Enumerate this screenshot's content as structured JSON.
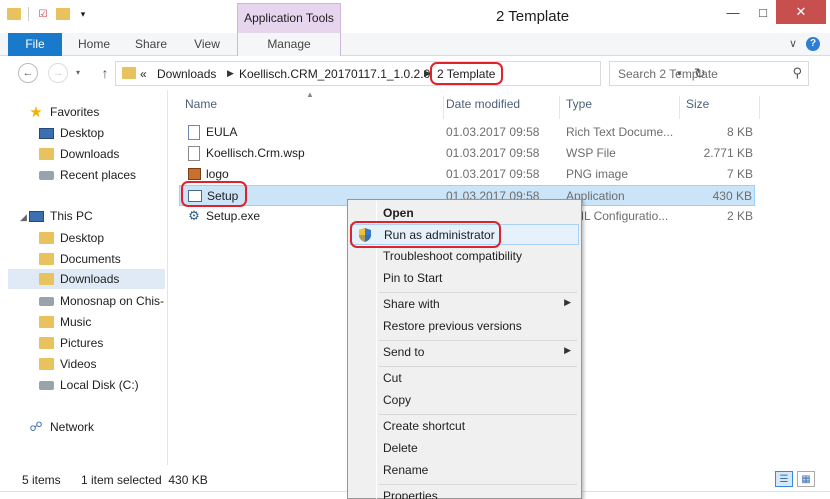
{
  "window": {
    "title": "2 Template",
    "contextual_tab_group": "Application Tools"
  },
  "ribbon": {
    "tabs": [
      "File",
      "Home",
      "Share",
      "View",
      "Manage"
    ]
  },
  "address": {
    "overflow": "«",
    "crumbs": [
      "Downloads",
      "Koellisch.CRM_20170117.1_1.0.2.0",
      "2 Template"
    ],
    "search_placeholder": "Search 2 Template"
  },
  "nav": {
    "favorites": {
      "label": "Favorites",
      "items": [
        "Desktop",
        "Downloads",
        "Recent places"
      ]
    },
    "this_pc": {
      "label": "This PC",
      "items": [
        "Desktop",
        "Documents",
        "Downloads",
        "Monosnap on Chis-",
        "Music",
        "Pictures",
        "Videos",
        "Local Disk (C:)"
      ]
    },
    "network": {
      "label": "Network"
    }
  },
  "columns": [
    "Name",
    "Date modified",
    "Type",
    "Size"
  ],
  "files": [
    {
      "name": "EULA",
      "date": "01.03.2017 09:58",
      "type": "Rich Text Docume...",
      "size": "8 KB",
      "icon": "rtf-icon"
    },
    {
      "name": "Koellisch.Crm.wsp",
      "date": "01.03.2017 09:58",
      "type": "WSP File",
      "size": "2.771 KB",
      "icon": "doc-icon"
    },
    {
      "name": "logo",
      "date": "01.03.2017 09:58",
      "type": "PNG image",
      "size": "7 KB",
      "icon": "png-icon"
    },
    {
      "name": "Setup",
      "date": "01.03.2017 09:58",
      "type": "Application",
      "size": "430 KB",
      "icon": "app-icon"
    },
    {
      "name": "Setup.exe",
      "date": "",
      "type": "XML Configuratio...",
      "size": "2 KB",
      "icon": "config-icon"
    }
  ],
  "status": {
    "items": "5 items",
    "selected": "1 item selected  430 KB"
  },
  "context_menu": {
    "open": "Open",
    "run_as_admin": "Run as administrator",
    "troubleshoot": "Troubleshoot compatibility",
    "pin_start": "Pin to Start",
    "share_with": "Share with",
    "restore": "Restore previous versions",
    "send_to": "Send to",
    "cut": "Cut",
    "copy": "Copy",
    "create_shortcut": "Create shortcut",
    "delete": "Delete",
    "rename": "Rename",
    "properties": "Properties"
  },
  "colors": {
    "file_tab": "#1979ca",
    "context_tab": "#e7d5ee",
    "selection": "#cce4f7",
    "highlight_ring": "#e0222c",
    "close_button": "#c7504f"
  }
}
